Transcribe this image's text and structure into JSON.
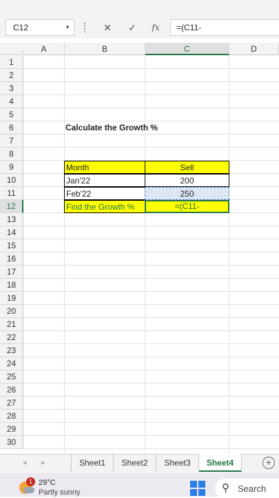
{
  "formula_bar": {
    "name_box": "C12",
    "cancel_icon": "✕",
    "enter_icon": "✓",
    "fx_label": "fx",
    "formula": "=(C11-"
  },
  "columns": [
    "A",
    "B",
    "C",
    "D"
  ],
  "rows": [
    "1",
    "2",
    "3",
    "4",
    "5",
    "6",
    "7",
    "8",
    "9",
    "10",
    "11",
    "12",
    "13",
    "14",
    "15",
    "16",
    "17",
    "18",
    "19",
    "20",
    "21",
    "22",
    "23",
    "24",
    "25",
    "26",
    "27",
    "28",
    "29",
    "30"
  ],
  "selected_cell": {
    "column": "C",
    "row": "12"
  },
  "cells": {
    "B6": "Calculate the Growth %",
    "B9": "Month",
    "C9": "Sell",
    "B10": "Jan'22",
    "C10": "200",
    "B11": "Feb'22",
    "C11": "250",
    "B12": "Find the Growth %",
    "C12": "=(C11-"
  },
  "sheet_tabs": [
    "Sheet1",
    "Sheet2",
    "Sheet3",
    "Sheet4"
  ],
  "active_sheet": "Sheet4",
  "taskbar": {
    "notification_count": "1",
    "temperature": "29°C",
    "condition": "Partly sunny",
    "search_label": "Search"
  },
  "colors": {
    "highlight": "#ffff00",
    "excel_green": "#217346",
    "selection_blue": "#dce6f4"
  }
}
